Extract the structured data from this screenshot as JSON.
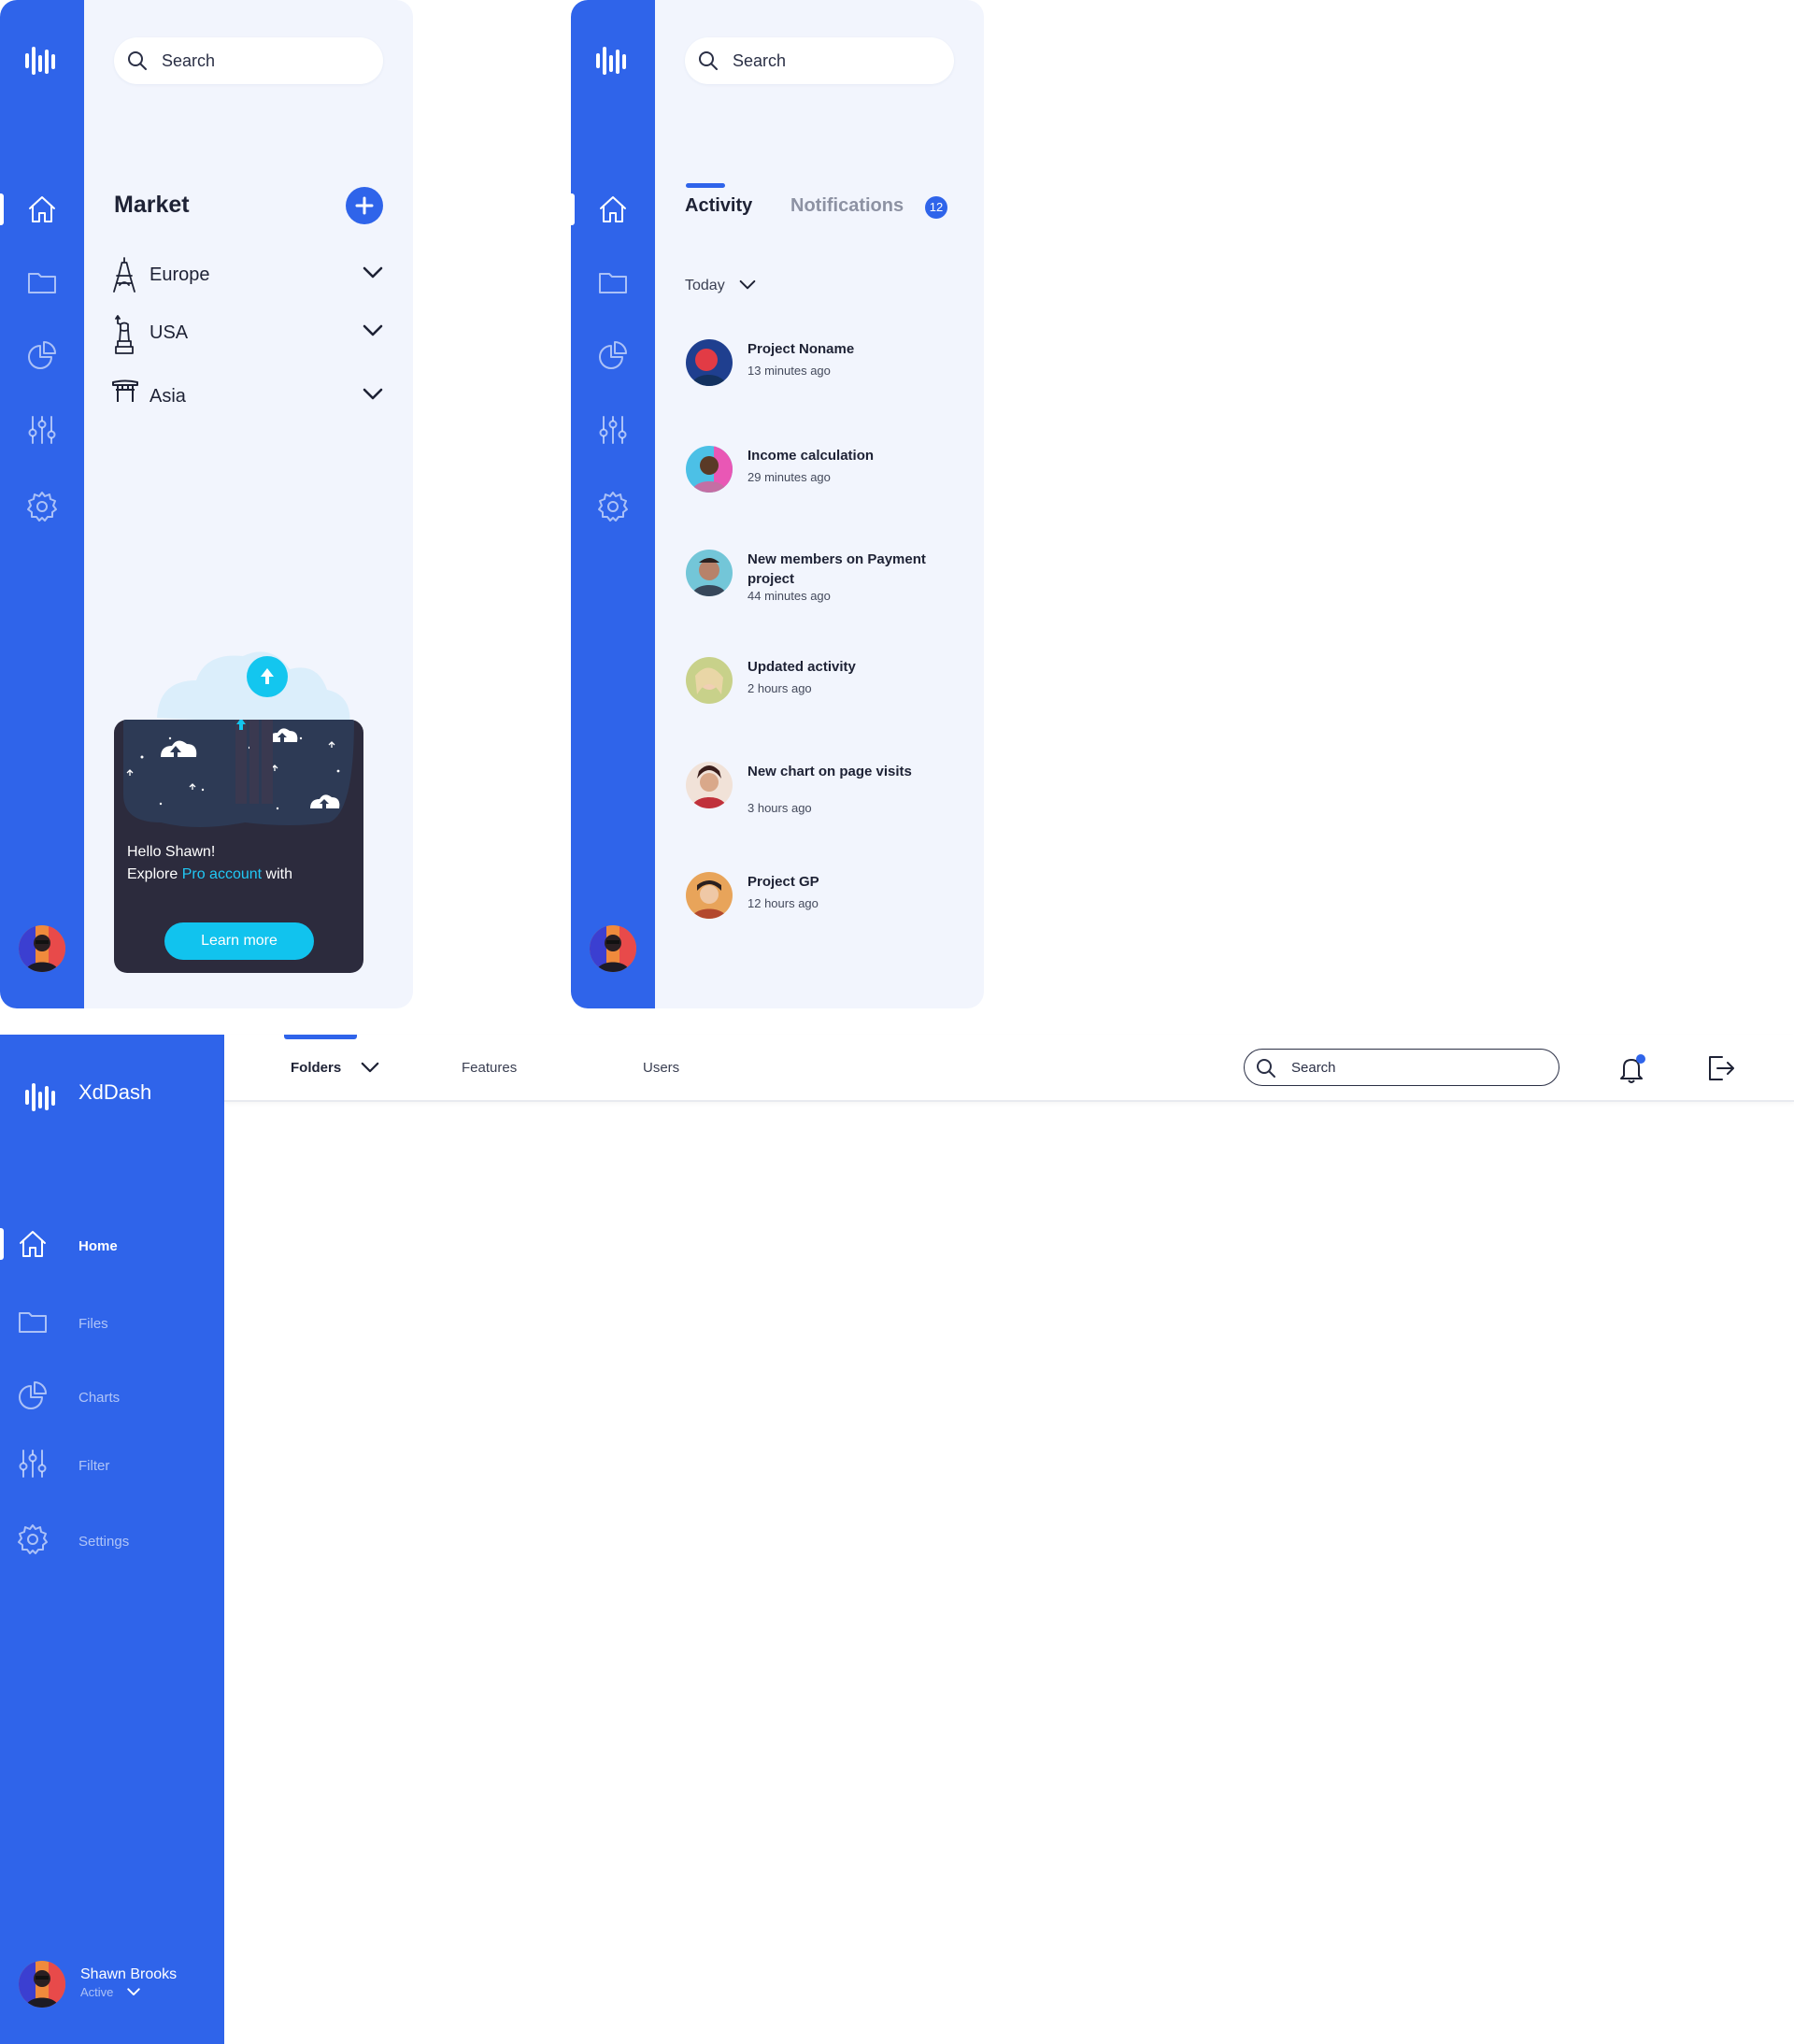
{
  "panel_market": {
    "search_placeholder": "Search",
    "title": "Market",
    "regions": [
      {
        "label": "Europe",
        "icon": "eiffel-tower-icon"
      },
      {
        "label": "USA",
        "icon": "statue-of-liberty-icon"
      },
      {
        "label": "Asia",
        "icon": "torii-gate-icon"
      }
    ],
    "promo": {
      "greeting": "Hello Shawn!",
      "line2_prefix": "Explore ",
      "line2_highlight": "Pro account",
      "line2_suffix": " with",
      "button": "Learn more"
    }
  },
  "panel_activity": {
    "search_placeholder": "Search",
    "tabs": {
      "activity": "Activity",
      "notifications": "Notifications",
      "notifications_count": "12"
    },
    "filter": "Today",
    "feed": [
      {
        "title": "Project Noname",
        "time": "13 minutes ago"
      },
      {
        "title": "Income calculation",
        "time": "29 minutes ago"
      },
      {
        "title": "New members on Payment project",
        "time": "44 minutes ago"
      },
      {
        "title": "Updated activity",
        "time": "2 hours ago"
      },
      {
        "title": "New chart on page visits",
        "time": "3 hours ago"
      },
      {
        "title": "Project GP",
        "time": "12 hours ago"
      }
    ]
  },
  "dashboard": {
    "brand": "XdDash",
    "nav": [
      {
        "label": "Home",
        "icon": "home-icon",
        "active": true
      },
      {
        "label": "Files",
        "icon": "folder-icon"
      },
      {
        "label": "Charts",
        "icon": "pie-chart-icon"
      },
      {
        "label": "Filter",
        "icon": "sliders-icon"
      },
      {
        "label": "Settings",
        "icon": "gear-icon"
      }
    ],
    "user": {
      "name": "Shawn Brooks",
      "status": "Active"
    },
    "topbar": {
      "tabs": [
        "Folders",
        "Features",
        "Users"
      ],
      "search_placeholder": "Search"
    }
  },
  "colors": {
    "accent": "#2f64ea",
    "panel_bg": "#f2f5fd",
    "promo_bg": "#2c2b3d",
    "cyan": "#11c3ee"
  }
}
